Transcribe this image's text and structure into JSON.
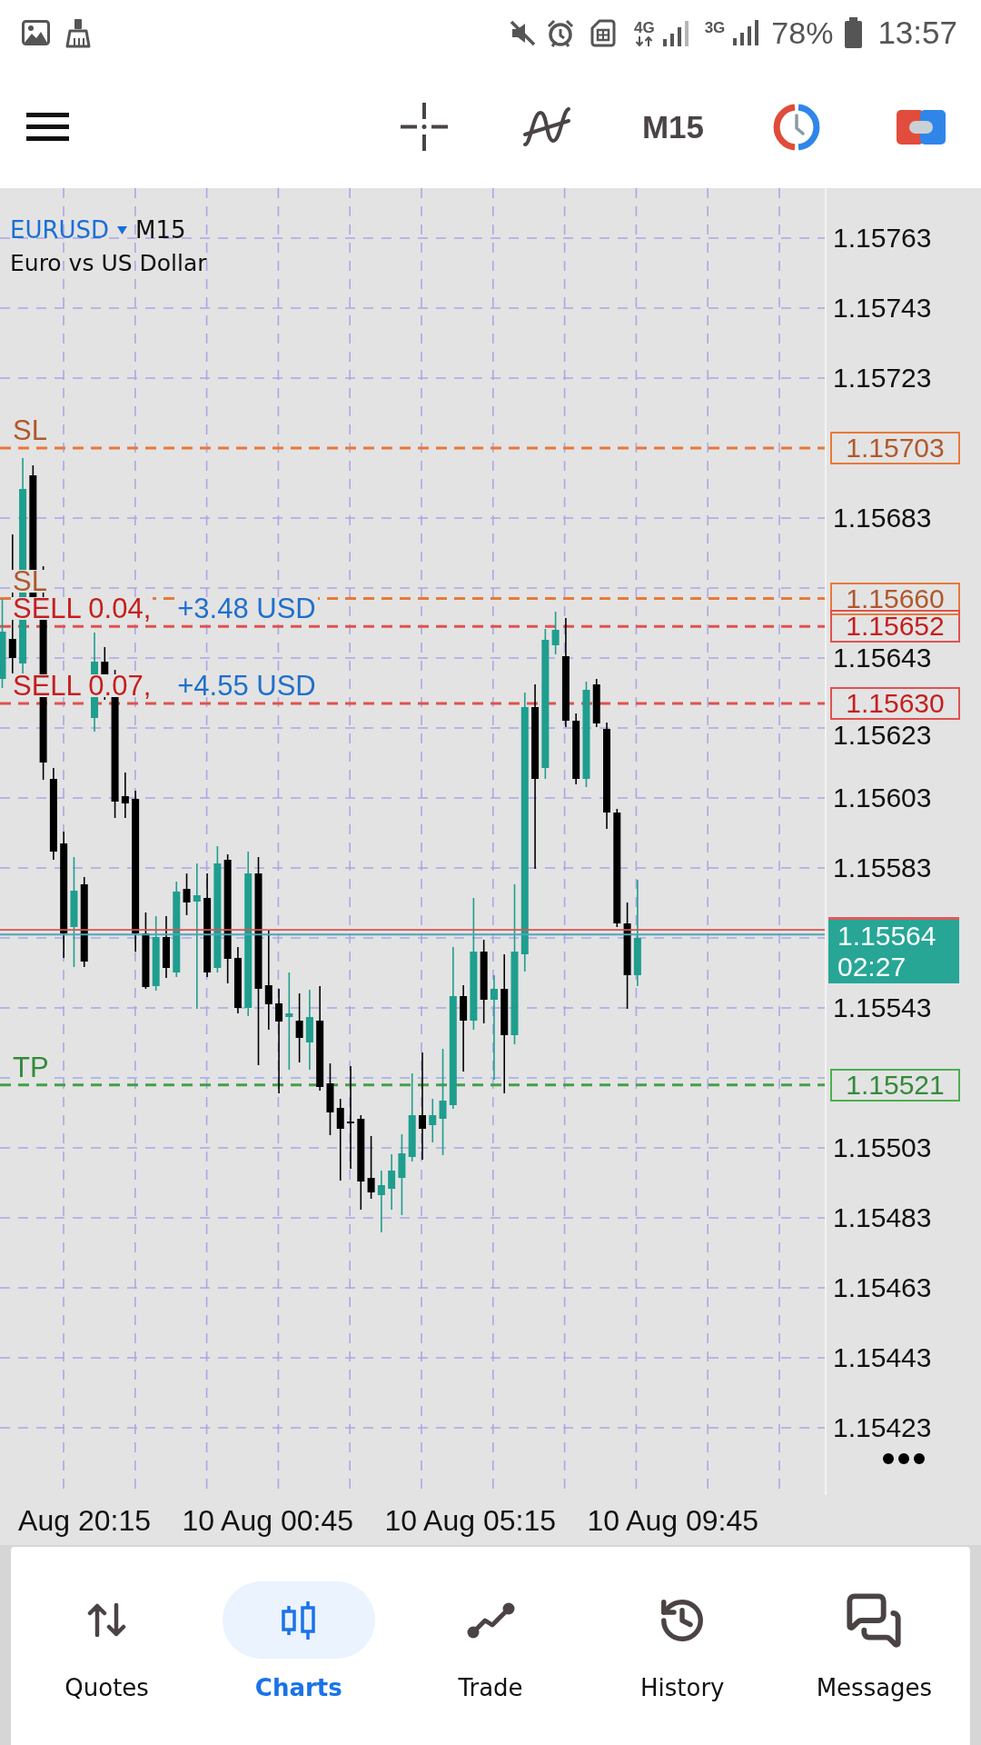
{
  "status_bar": {
    "network_types": [
      "4G",
      "3G"
    ],
    "battery": "78%",
    "time": "13:57"
  },
  "toolbar": {
    "timeframe": "M15"
  },
  "chart": {
    "symbol": "EURUSD",
    "timeframe": "M15",
    "description": "Euro vs US Dollar",
    "price_axis": [
      "1.15763",
      "1.15743",
      "1.15723",
      "1.15683",
      "1.15643",
      "1.15623",
      "1.15603",
      "1.15583",
      "1.15543",
      "1.15503",
      "1.15483",
      "1.15463",
      "1.15443",
      "1.15423"
    ],
    "levels": [
      {
        "kind": "stop_loss",
        "label": "SL",
        "price": "1.15703"
      },
      {
        "kind": "stop_loss",
        "label": "SL",
        "price": "1.15660"
      },
      {
        "kind": "order",
        "label": "SELL 0.04,",
        "profit": "+3.48 USD",
        "price": "1.15652"
      },
      {
        "kind": "order",
        "label": "SELL 0.07,",
        "profit": "+4.55 USD",
        "price": "1.15630"
      },
      {
        "kind": "take_profit",
        "label": "TP",
        "price": "1.15521"
      }
    ],
    "current_price": {
      "price": "1.15564",
      "countdown": "02:27"
    },
    "time_axis": [
      "Aug 20:15",
      "10 Aug 00:45",
      "10 Aug 05:15",
      "10 Aug 09:45"
    ]
  },
  "bottom_nav": [
    {
      "label": "Quotes",
      "selected": false
    },
    {
      "label": "Charts",
      "selected": true
    },
    {
      "label": "Trade",
      "selected": false
    },
    {
      "label": "History",
      "selected": false
    },
    {
      "label": "Messages",
      "selected": false
    }
  ]
}
